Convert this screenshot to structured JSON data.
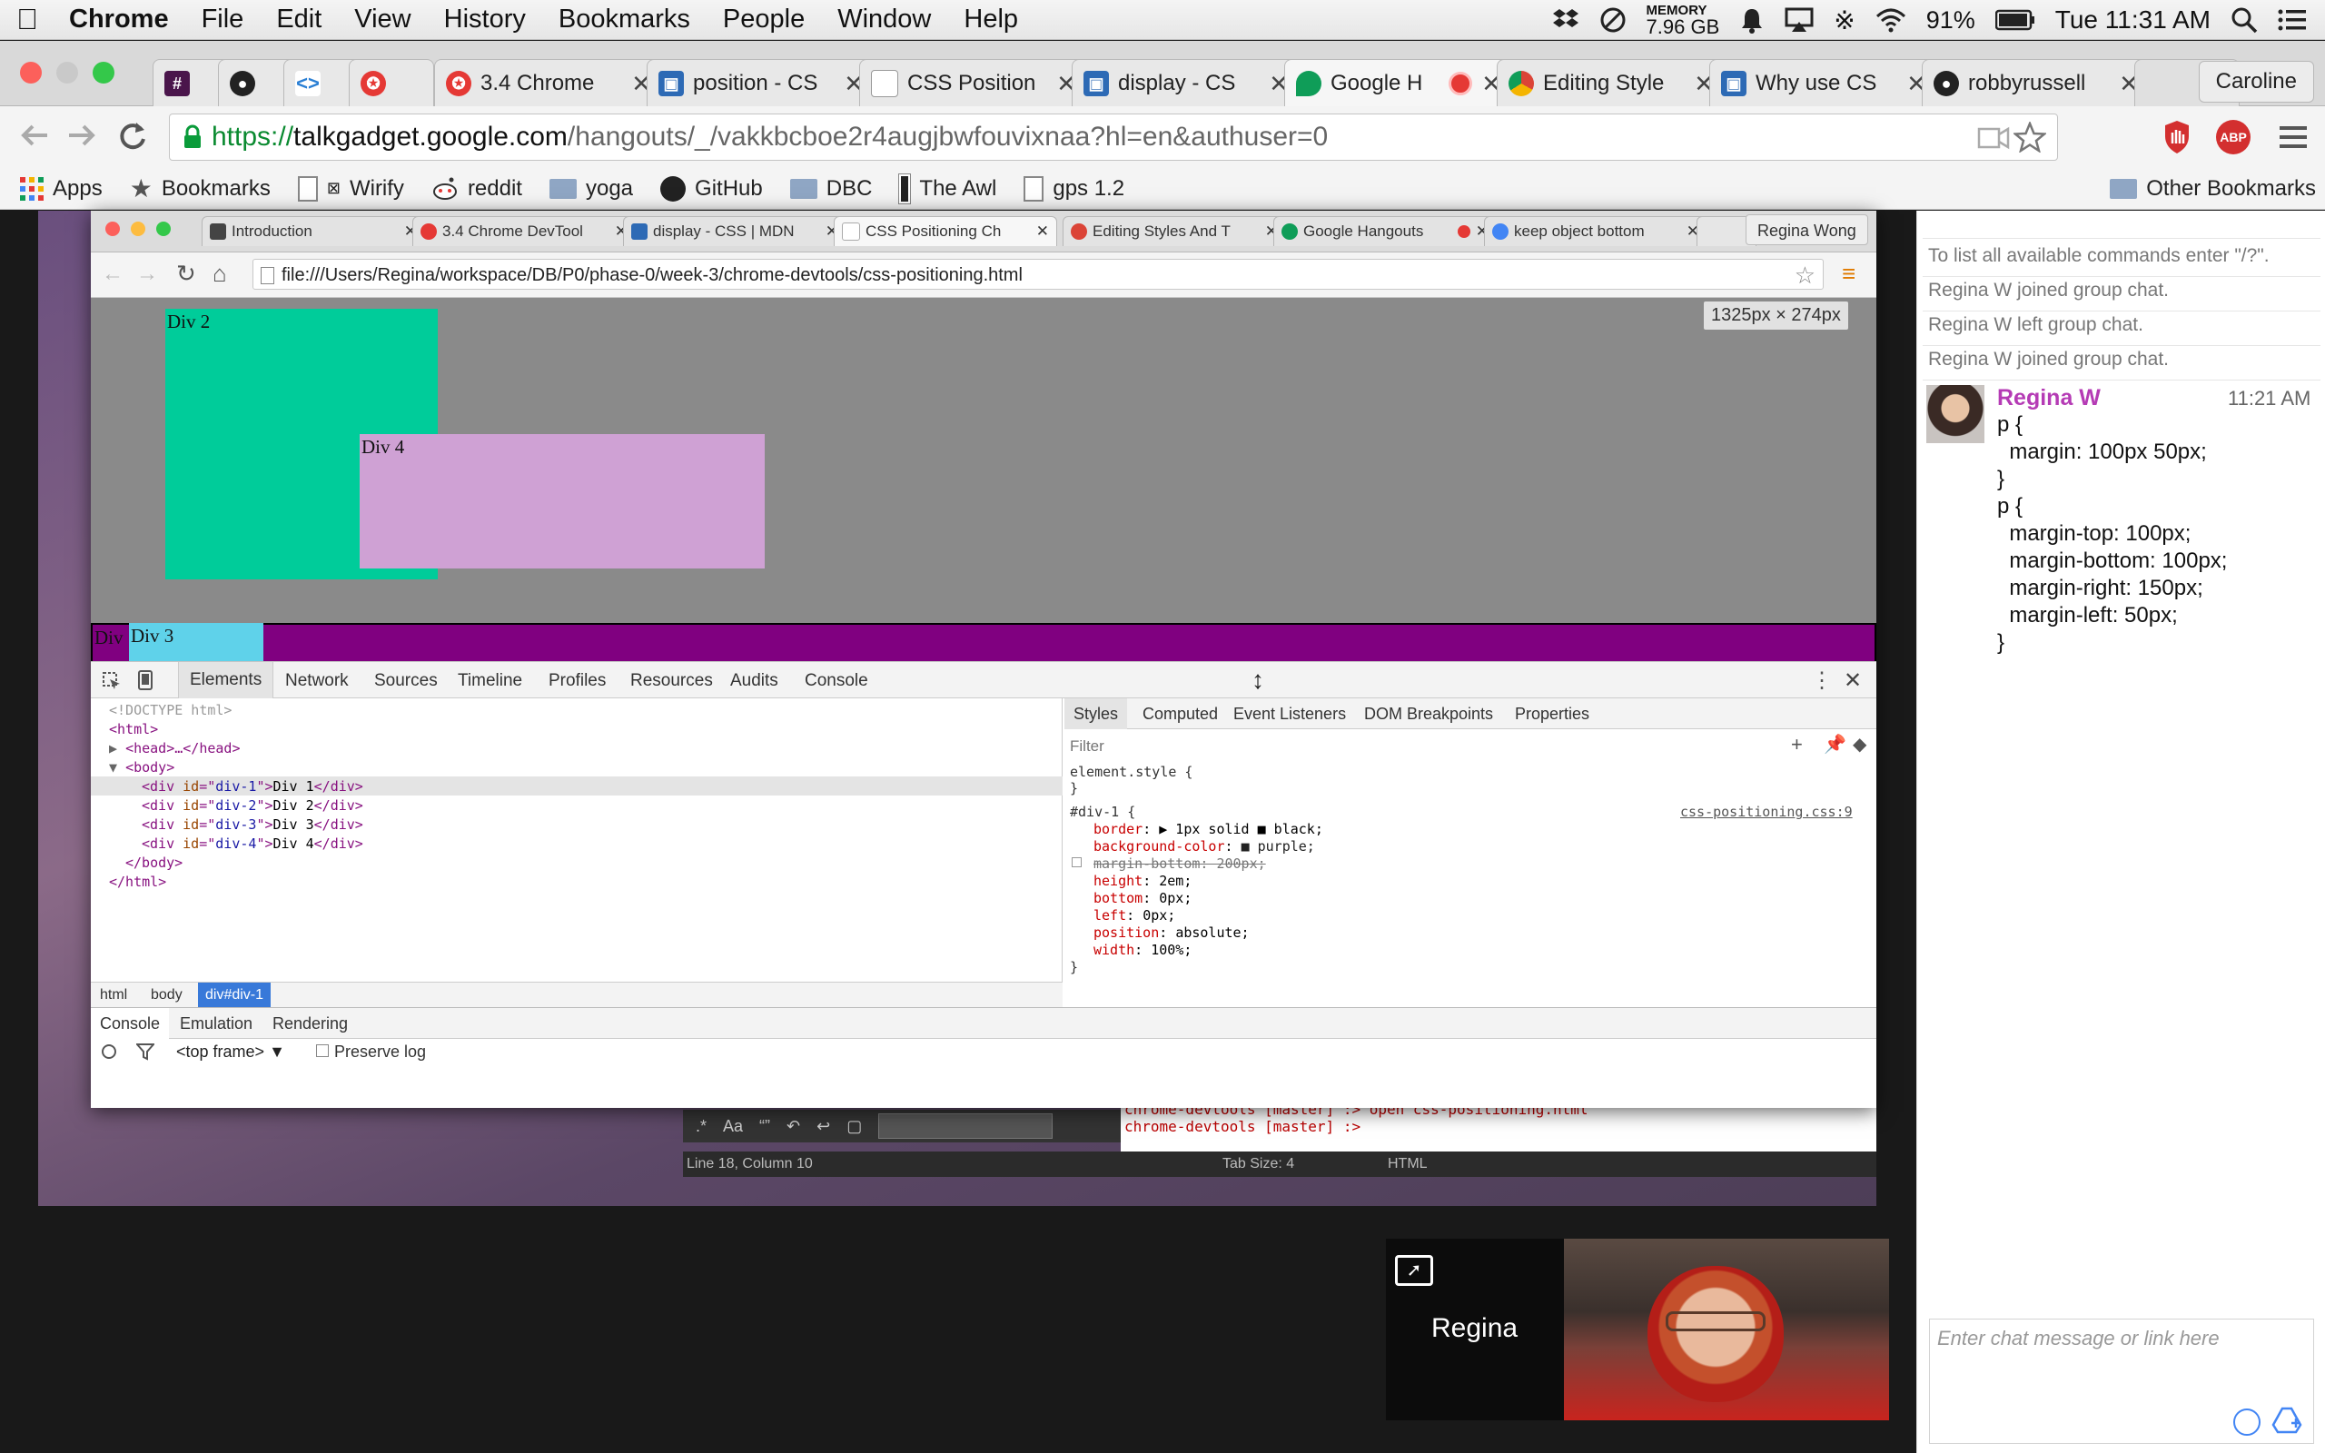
{
  "menubar": {
    "app": "Chrome",
    "items": [
      "File",
      "Edit",
      "View",
      "History",
      "Bookmarks",
      "People",
      "Window",
      "Help"
    ],
    "memory_label": "MEMORY",
    "memory_value": "7.96 GB",
    "battery": "91%",
    "clock": "Tue 11:31 AM"
  },
  "tabs": [
    {
      "title": "",
      "icon": "slack-icon",
      "color": "#4a154b"
    },
    {
      "title": "",
      "icon": "github-icon",
      "color": "#222222"
    },
    {
      "title": "",
      "icon": "code-icon",
      "color": "#2a7fd4"
    },
    {
      "title": "",
      "icon": "pinwheel-icon",
      "color": "#e53935"
    },
    {
      "title": "3.4 Chrome",
      "icon": "pinwheel-icon",
      "color": "#e53935"
    },
    {
      "title": "position - CS",
      "icon": "mdn-icon",
      "color": "#2d6ab5"
    },
    {
      "title": "CSS Position",
      "icon": "page-icon",
      "color": "#bbbbbb"
    },
    {
      "title": "display - CS",
      "icon": "mdn-icon",
      "color": "#2d6ab5"
    },
    {
      "title": "Google H",
      "icon": "hangouts-icon",
      "color": "#0f9d58",
      "active": true
    },
    {
      "title": "Editing Style",
      "icon": "chrome-icon",
      "color": "#db4437"
    },
    {
      "title": "Why use CS",
      "icon": "mdn-icon",
      "color": "#2d6ab5"
    },
    {
      "title": "robbyrussell",
      "icon": "github-icon",
      "color": "#222222"
    }
  ],
  "profile": "Caroline",
  "omnibox": {
    "scheme": "https://",
    "host": "talkgadget.google.com",
    "path": "/hangouts/_/vakkbcboe2r4augjbwfouvixnaa?hl=en&authuser=0"
  },
  "bookmarks": [
    {
      "label": "Apps",
      "icon": "apps-grid-icon"
    },
    {
      "label": "Bookmarks",
      "icon": "star-icon"
    },
    {
      "label": "Wirify",
      "icon": "page-icon"
    },
    {
      "label": "reddit",
      "icon": "reddit-icon"
    },
    {
      "label": "yoga",
      "icon": "folder-icon"
    },
    {
      "label": "GitHub",
      "icon": "github-icon"
    },
    {
      "label": "DBC",
      "icon": "folder-icon"
    },
    {
      "label": "The Awl",
      "icon": "page-icon"
    },
    {
      "label": "gps 1.2",
      "icon": "page-icon"
    }
  ],
  "other_bookmarks": "Other Bookmarks",
  "inner": {
    "tabs": [
      {
        "title": "Introduction",
        "color": "#444444"
      },
      {
        "title": "3.4 Chrome DevTool",
        "color": "#e53935"
      },
      {
        "title": "display - CSS | MDN",
        "color": "#2d6ab5"
      },
      {
        "title": "CSS Positioning Ch",
        "color": "#cccccc",
        "active": true
      },
      {
        "title": "Editing Styles And T",
        "color": "#db4437"
      },
      {
        "title": "Google Hangouts",
        "color": "#0f9d58"
      },
      {
        "title": "keep object bottom",
        "color": "#4285f4"
      }
    ],
    "profile": "Regina Wong",
    "url": "file:///Users/Regina/workspace/DB/P0/phase-0/week-3/chrome-devtools/css-positioning.html",
    "size_tooltip": "1325px × 274px",
    "div2": "Div 2",
    "div4": "Div 4",
    "div3": "Div 3",
    "div1": "Div",
    "colors": {
      "div2": "#00cc9a",
      "div4": "#cfa1d4",
      "div3": "#5fd2ea",
      "div1": "#800080"
    }
  },
  "devtools": {
    "tabs": [
      "Elements",
      "Network",
      "Sources",
      "Timeline",
      "Profiles",
      "Resources",
      "Audits",
      "Console"
    ],
    "dom": {
      "doctype": "<!DOCTYPE html>",
      "html_open": "<html>",
      "head": "<head>…</head>",
      "body_open": "<body>",
      "rows": [
        {
          "id": "div-1",
          "text": "Div 1"
        },
        {
          "id": "div-2",
          "text": "Div 2"
        },
        {
          "id": "div-3",
          "text": "Div 3"
        },
        {
          "id": "div-4",
          "text": "Div 4"
        }
      ],
      "body_close": "</body>",
      "html_close": "</html>"
    },
    "breadcrumbs": [
      "html",
      "body",
      "div#div-1"
    ],
    "styles_tabs": [
      "Styles",
      "Computed",
      "Event Listeners",
      "DOM Breakpoints",
      "Properties"
    ],
    "filter_placeholder": "Filter",
    "element_style": "element.style {",
    "close_brace": "}",
    "selector": "#div-1 {",
    "source_link": "css-positioning.css:9",
    "rules": [
      {
        "prop": "border",
        "value": "▶ 1px solid ■ black;"
      },
      {
        "prop": "background-color",
        "value": "■ purple;"
      },
      {
        "prop": "margin-bottom",
        "value": "200px;",
        "struck": true
      },
      {
        "prop": "height",
        "value": "2em;"
      },
      {
        "prop": "bottom",
        "value": "0px;"
      },
      {
        "prop": "left",
        "value": "0px;"
      },
      {
        "prop": "position",
        "value": "absolute;"
      },
      {
        "prop": "width",
        "value": "100%;"
      }
    ],
    "drawer_tabs": [
      "Console",
      "Emulation",
      "Rendering"
    ],
    "frame_select": "<top frame>",
    "preserve_log": "Preserve log"
  },
  "editor": {
    "status": "Line 18, Column 10",
    "tab_size": "Tab Size: 4",
    "syntax": "HTML",
    "terminal_lines": [
      "chrome-devtools [master] :> open css-positioning.html",
      "chrome-devtools [master] :> "
    ]
  },
  "chat": {
    "system": [
      "To list all available commands enter \"/?\".",
      "Regina W joined group chat.",
      "Regina W left group chat.",
      "Regina W joined group chat."
    ],
    "sender": "Regina W",
    "time": "11:21 AM",
    "lines": [
      "p {",
      "  margin: 100px 50px;",
      "}",
      "p {",
      "  margin-top: 100px;",
      "  margin-bottom: 100px;",
      "  margin-right: 150px;",
      "  margin-left: 50px;",
      "}"
    ],
    "input_placeholder": "Enter chat message or link here"
  },
  "video": {
    "name": "Regina"
  }
}
